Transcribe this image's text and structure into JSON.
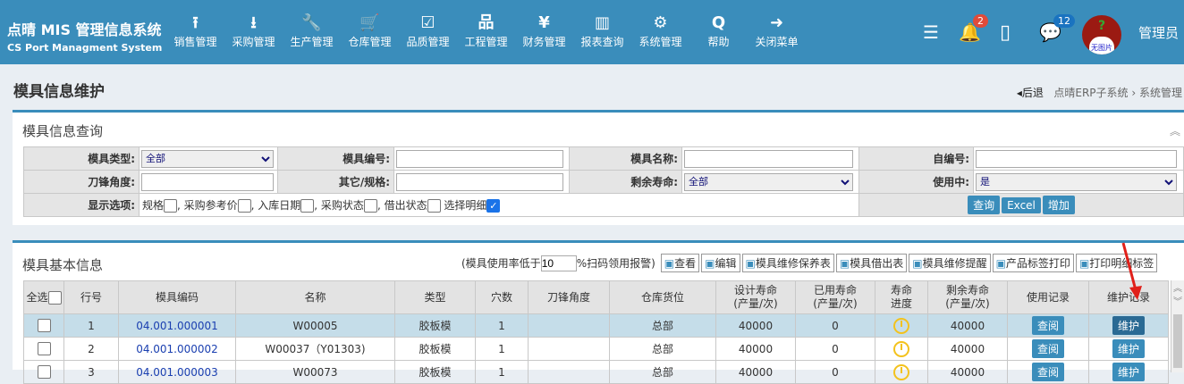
{
  "header": {
    "brand_title": "点晴 MIS 管理信息系统",
    "brand_subtitle": "CS Port Managment System",
    "nav": [
      {
        "icon": "upload-icon",
        "glyph": "⭱",
        "label": "销售管理"
      },
      {
        "icon": "download-icon",
        "glyph": "⭳",
        "label": "采购管理"
      },
      {
        "icon": "wrench-icon",
        "glyph": "🔧",
        "label": "生产管理"
      },
      {
        "icon": "cart-icon",
        "glyph": "🛒",
        "label": "仓库管理"
      },
      {
        "icon": "checkbox-icon",
        "glyph": "☑",
        "label": "品质管理"
      },
      {
        "icon": "sitemap-icon",
        "glyph": "品",
        "label": "工程管理"
      },
      {
        "icon": "yen-icon",
        "glyph": "¥",
        "label": "财务管理"
      },
      {
        "icon": "bar-chart-icon",
        "glyph": "▥",
        "label": "报表查询"
      },
      {
        "icon": "gear-icon",
        "glyph": "⚙",
        "label": "系统管理"
      },
      {
        "icon": "search-icon",
        "glyph": "Q",
        "label": "帮助"
      },
      {
        "icon": "sign-out-icon",
        "glyph": "➜",
        "label": "关闭菜单"
      }
    ],
    "notifications_count": "2",
    "messages_count": "12",
    "avatar_text": "无图片",
    "username": "管理员"
  },
  "page": {
    "title": "模具信息维护",
    "back": "后退",
    "breadcrumb": [
      "点晴ERP子系统",
      "系统管理"
    ]
  },
  "query": {
    "title": "模具信息查询",
    "labels": [
      "模具类型:",
      "模具编号:",
      "模具名称:",
      "自编号:",
      "刀锋角度:",
      "其它/规格:",
      "剩余寿命:",
      "使用中:",
      "显示选项:"
    ],
    "type_value": "全部",
    "life_value": "全部",
    "in_use_value": "是",
    "options": [
      {
        "label": "规格",
        "checked": false
      },
      {
        "label": ", 采购参考价",
        "checked": false
      },
      {
        "label": ", 入库日期",
        "checked": false
      },
      {
        "label": ", 采购状态",
        "checked": false
      },
      {
        "label": ", 借出状态",
        "checked": false
      },
      {
        "label": " 选择明细",
        "checked": true
      }
    ],
    "buttons": [
      "查询",
      "Excel",
      "增加"
    ]
  },
  "list": {
    "title": "模具基本信息",
    "alarm_prefix": "(模具使用率低于",
    "alarm_value": "10",
    "alarm_suffix": "%扫码领用报警)",
    "toolbar": [
      "查看",
      "编辑",
      "模具维修保养表",
      "模具借出表",
      "模具维修提醒",
      "产品标签打印",
      "打印明细标签"
    ],
    "columns": [
      "全选",
      "行号",
      "模具编码",
      "名称",
      "类型",
      "穴数",
      "刀锋角度",
      "仓库货位",
      "设计寿命\n(产量/次)",
      "已用寿命\n(产量/次)",
      "寿命\n进度",
      "剩余寿命\n(产量/次)",
      "使用记录",
      "维护记录"
    ],
    "rows": [
      {
        "no": "1",
        "code": "04.001.000001",
        "name": "W00005",
        "type": "胶板模",
        "cavity": "1",
        "angle": "",
        "location": "总部",
        "design": "40000",
        "used": "0",
        "remain": "40000",
        "view": "查阅",
        "maint": "维护"
      },
      {
        "no": "2",
        "code": "04.001.000002",
        "name": "W00037（Y01303)",
        "type": "胶板模",
        "cavity": "1",
        "angle": "",
        "location": "总部",
        "design": "40000",
        "used": "0",
        "remain": "40000",
        "view": "查阅",
        "maint": "维护"
      },
      {
        "no": "3",
        "code": "04.001.000003",
        "name": "W00073",
        "type": "胶板模",
        "cavity": "1",
        "angle": "",
        "location": "总部",
        "design": "40000",
        "used": "0",
        "remain": "40000",
        "view": "查阅",
        "maint": "维护"
      }
    ]
  }
}
